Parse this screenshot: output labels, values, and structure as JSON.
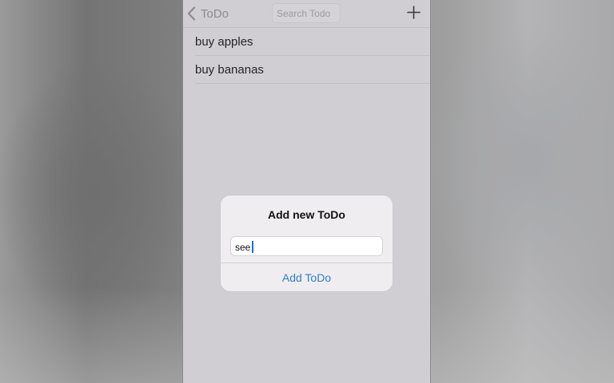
{
  "navbar": {
    "back_label": "ToDo",
    "search_placeholder": "Search Todo",
    "add_icon": "plus-icon",
    "back_icon": "chevron-left-icon"
  },
  "todos": [
    {
      "label": "buy apples"
    },
    {
      "label": "buy bananas"
    }
  ],
  "dialog": {
    "title": "Add new ToDo",
    "input_value": "see",
    "action_label": "Add ToDo"
  },
  "colors": {
    "accent": "#2f7fc9",
    "caret": "#1a6fd1",
    "screen_bg": "#d1ced3",
    "dialog_bg": "#efedf0"
  }
}
